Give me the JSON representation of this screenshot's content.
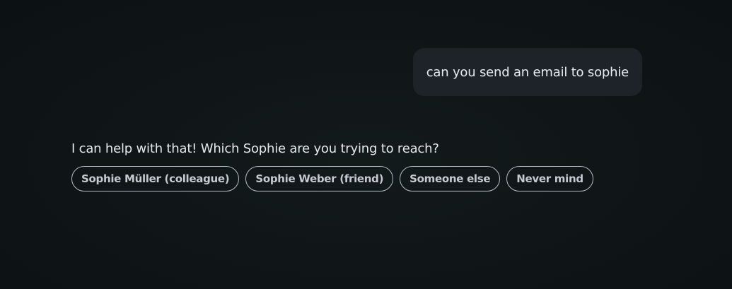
{
  "conversation": {
    "user_message": "can you send an email to sophie",
    "assistant_message": "I can help with that! Which Sophie are you trying to reach?",
    "options": [
      "Sophie Müller (colleague)",
      "Sophie Weber (friend)",
      "Someone else",
      "Never mind"
    ]
  }
}
